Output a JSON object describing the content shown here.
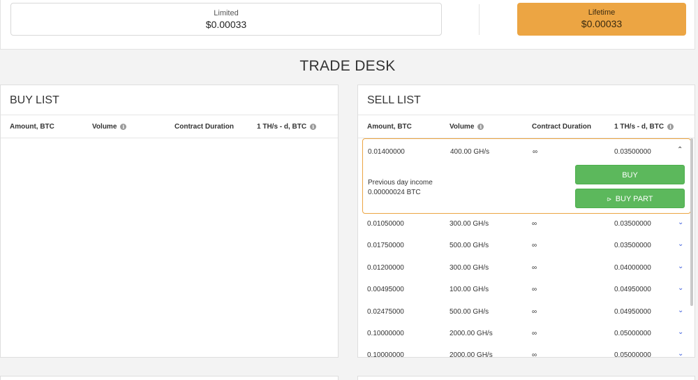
{
  "prices": {
    "limited": {
      "label": "Limited",
      "value": "$0.00033"
    },
    "lifetime": {
      "label": "Lifetime",
      "value": "$0.00033"
    }
  },
  "desk_title": "TRADE DESK",
  "buy_list": {
    "title": "BUY LIST",
    "headers": [
      "Amount, BTC",
      "Volume",
      "Contract Duration",
      "1 TH/s - d, BTC"
    ]
  },
  "sell_list": {
    "title": "SELL LIST",
    "headers": [
      "Amount, BTC",
      "Volume",
      "Contract Duration",
      "1 TH/s - d, BTC"
    ],
    "expanded": {
      "amount": "0.01400000",
      "volume": "400.00 GH/s",
      "duration": "∞",
      "price": "0.03500000",
      "prev_label": "Previous day income",
      "prev_value": "0.00000024 BTC",
      "buy_label": "BUY",
      "buy_part_label": "BUY PART"
    },
    "rows": [
      {
        "amount": "0.01050000",
        "volume": "300.00 GH/s",
        "duration": "∞",
        "price": "0.03500000"
      },
      {
        "amount": "0.01750000",
        "volume": "500.00 GH/s",
        "duration": "∞",
        "price": "0.03500000"
      },
      {
        "amount": "0.01200000",
        "volume": "300.00 GH/s",
        "duration": "∞",
        "price": "0.04000000"
      },
      {
        "amount": "0.00495000",
        "volume": "100.00 GH/s",
        "duration": "∞",
        "price": "0.04950000"
      },
      {
        "amount": "0.02475000",
        "volume": "500.00 GH/s",
        "duration": "∞",
        "price": "0.04950000"
      },
      {
        "amount": "0.10000000",
        "volume": "2000.00 GH/s",
        "duration": "∞",
        "price": "0.05000000"
      },
      {
        "amount": "0.10000000",
        "volume": "2000.00 GH/s",
        "duration": "∞",
        "price": "0.05000000"
      }
    ]
  },
  "icons": {
    "info": "info-icon",
    "chevron_down": "chevron-down-icon",
    "chevron_up": "chevron-up-icon",
    "share": "share-icon"
  },
  "colors": {
    "accent_orange": "#eca543",
    "button_green": "#5cb85c",
    "chevron_blue": "#3b5bdb"
  }
}
